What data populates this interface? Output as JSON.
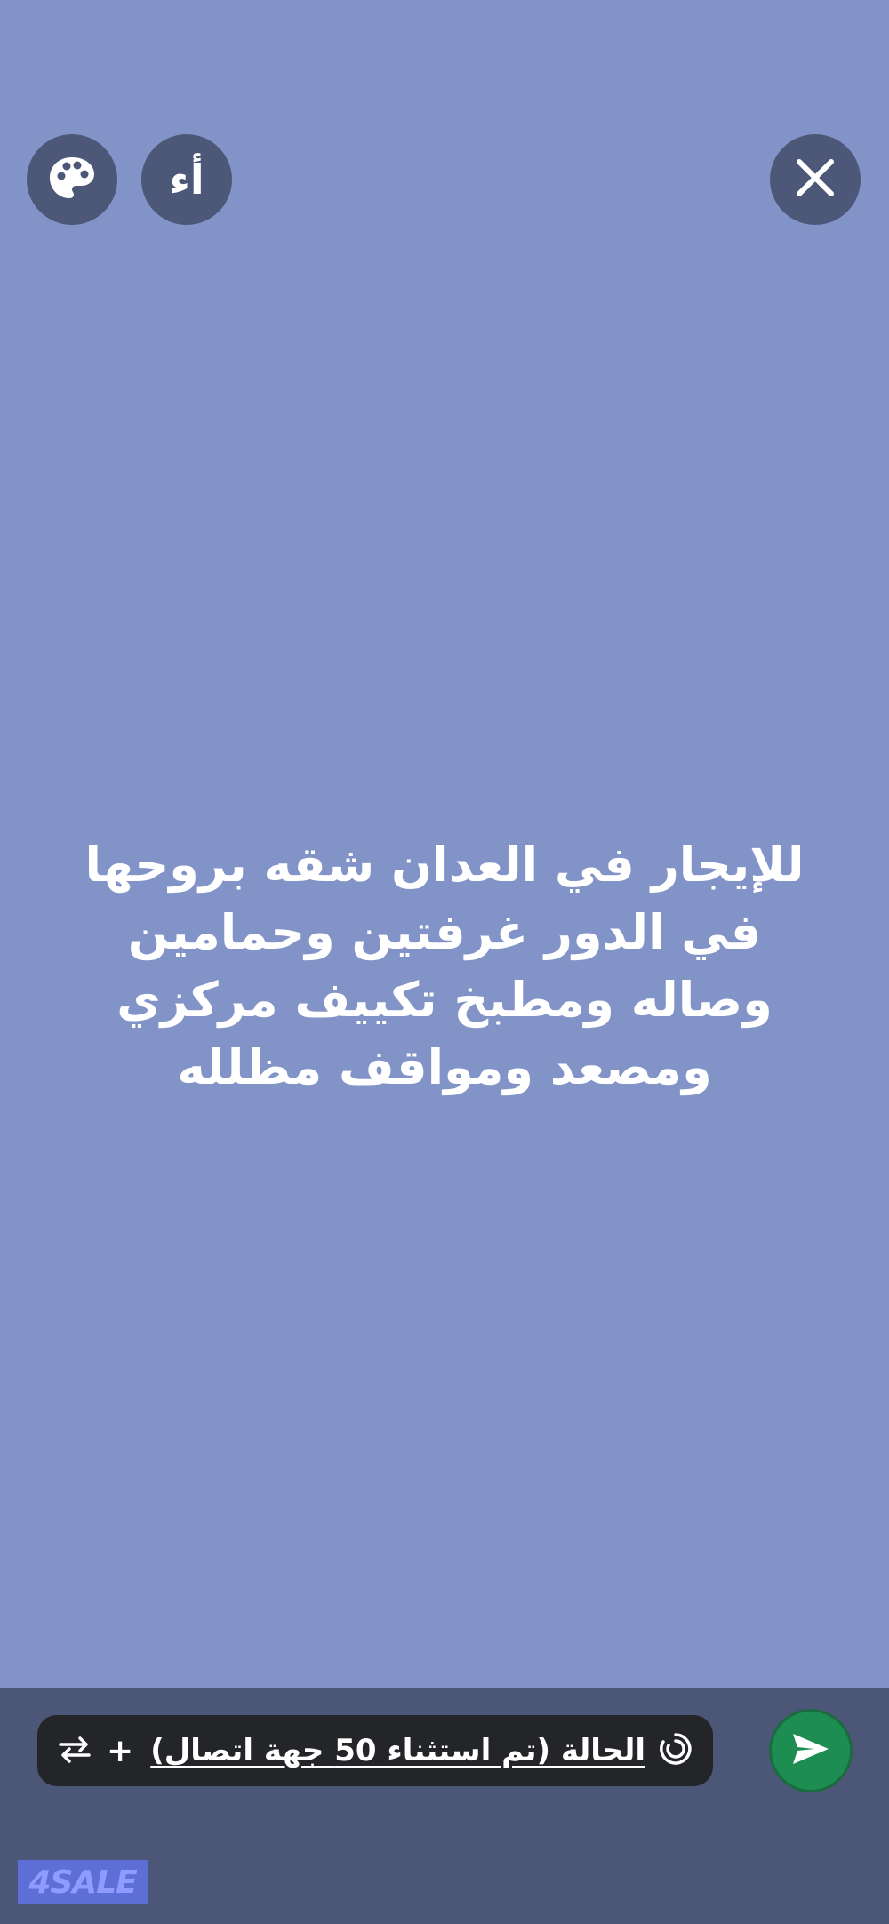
{
  "header": {
    "font_button_label": "أء",
    "icons": {
      "palette": "palette-icon",
      "close": "close-icon"
    }
  },
  "status": {
    "text": "للإيجار في العدان شقه بروحها في الدور غرفتين وحمامين وصاله ومطبخ تكييف مركزي ومصعد ومواقف مظلله"
  },
  "footer": {
    "audience_label": "الحالة (تم استثناء 50 جهة اتصال)",
    "plus_label": "+",
    "icons": {
      "status": "status-ring-icon",
      "switch": "switch-arrows-icon",
      "send": "send-icon"
    }
  },
  "watermark": {
    "brand": "4SALE"
  },
  "colors": {
    "background": "#8293c8",
    "button_bg": "#4d5777",
    "bar_bg": "#4c5677",
    "pill_bg": "#242528",
    "send_green": "#1e8d52"
  }
}
